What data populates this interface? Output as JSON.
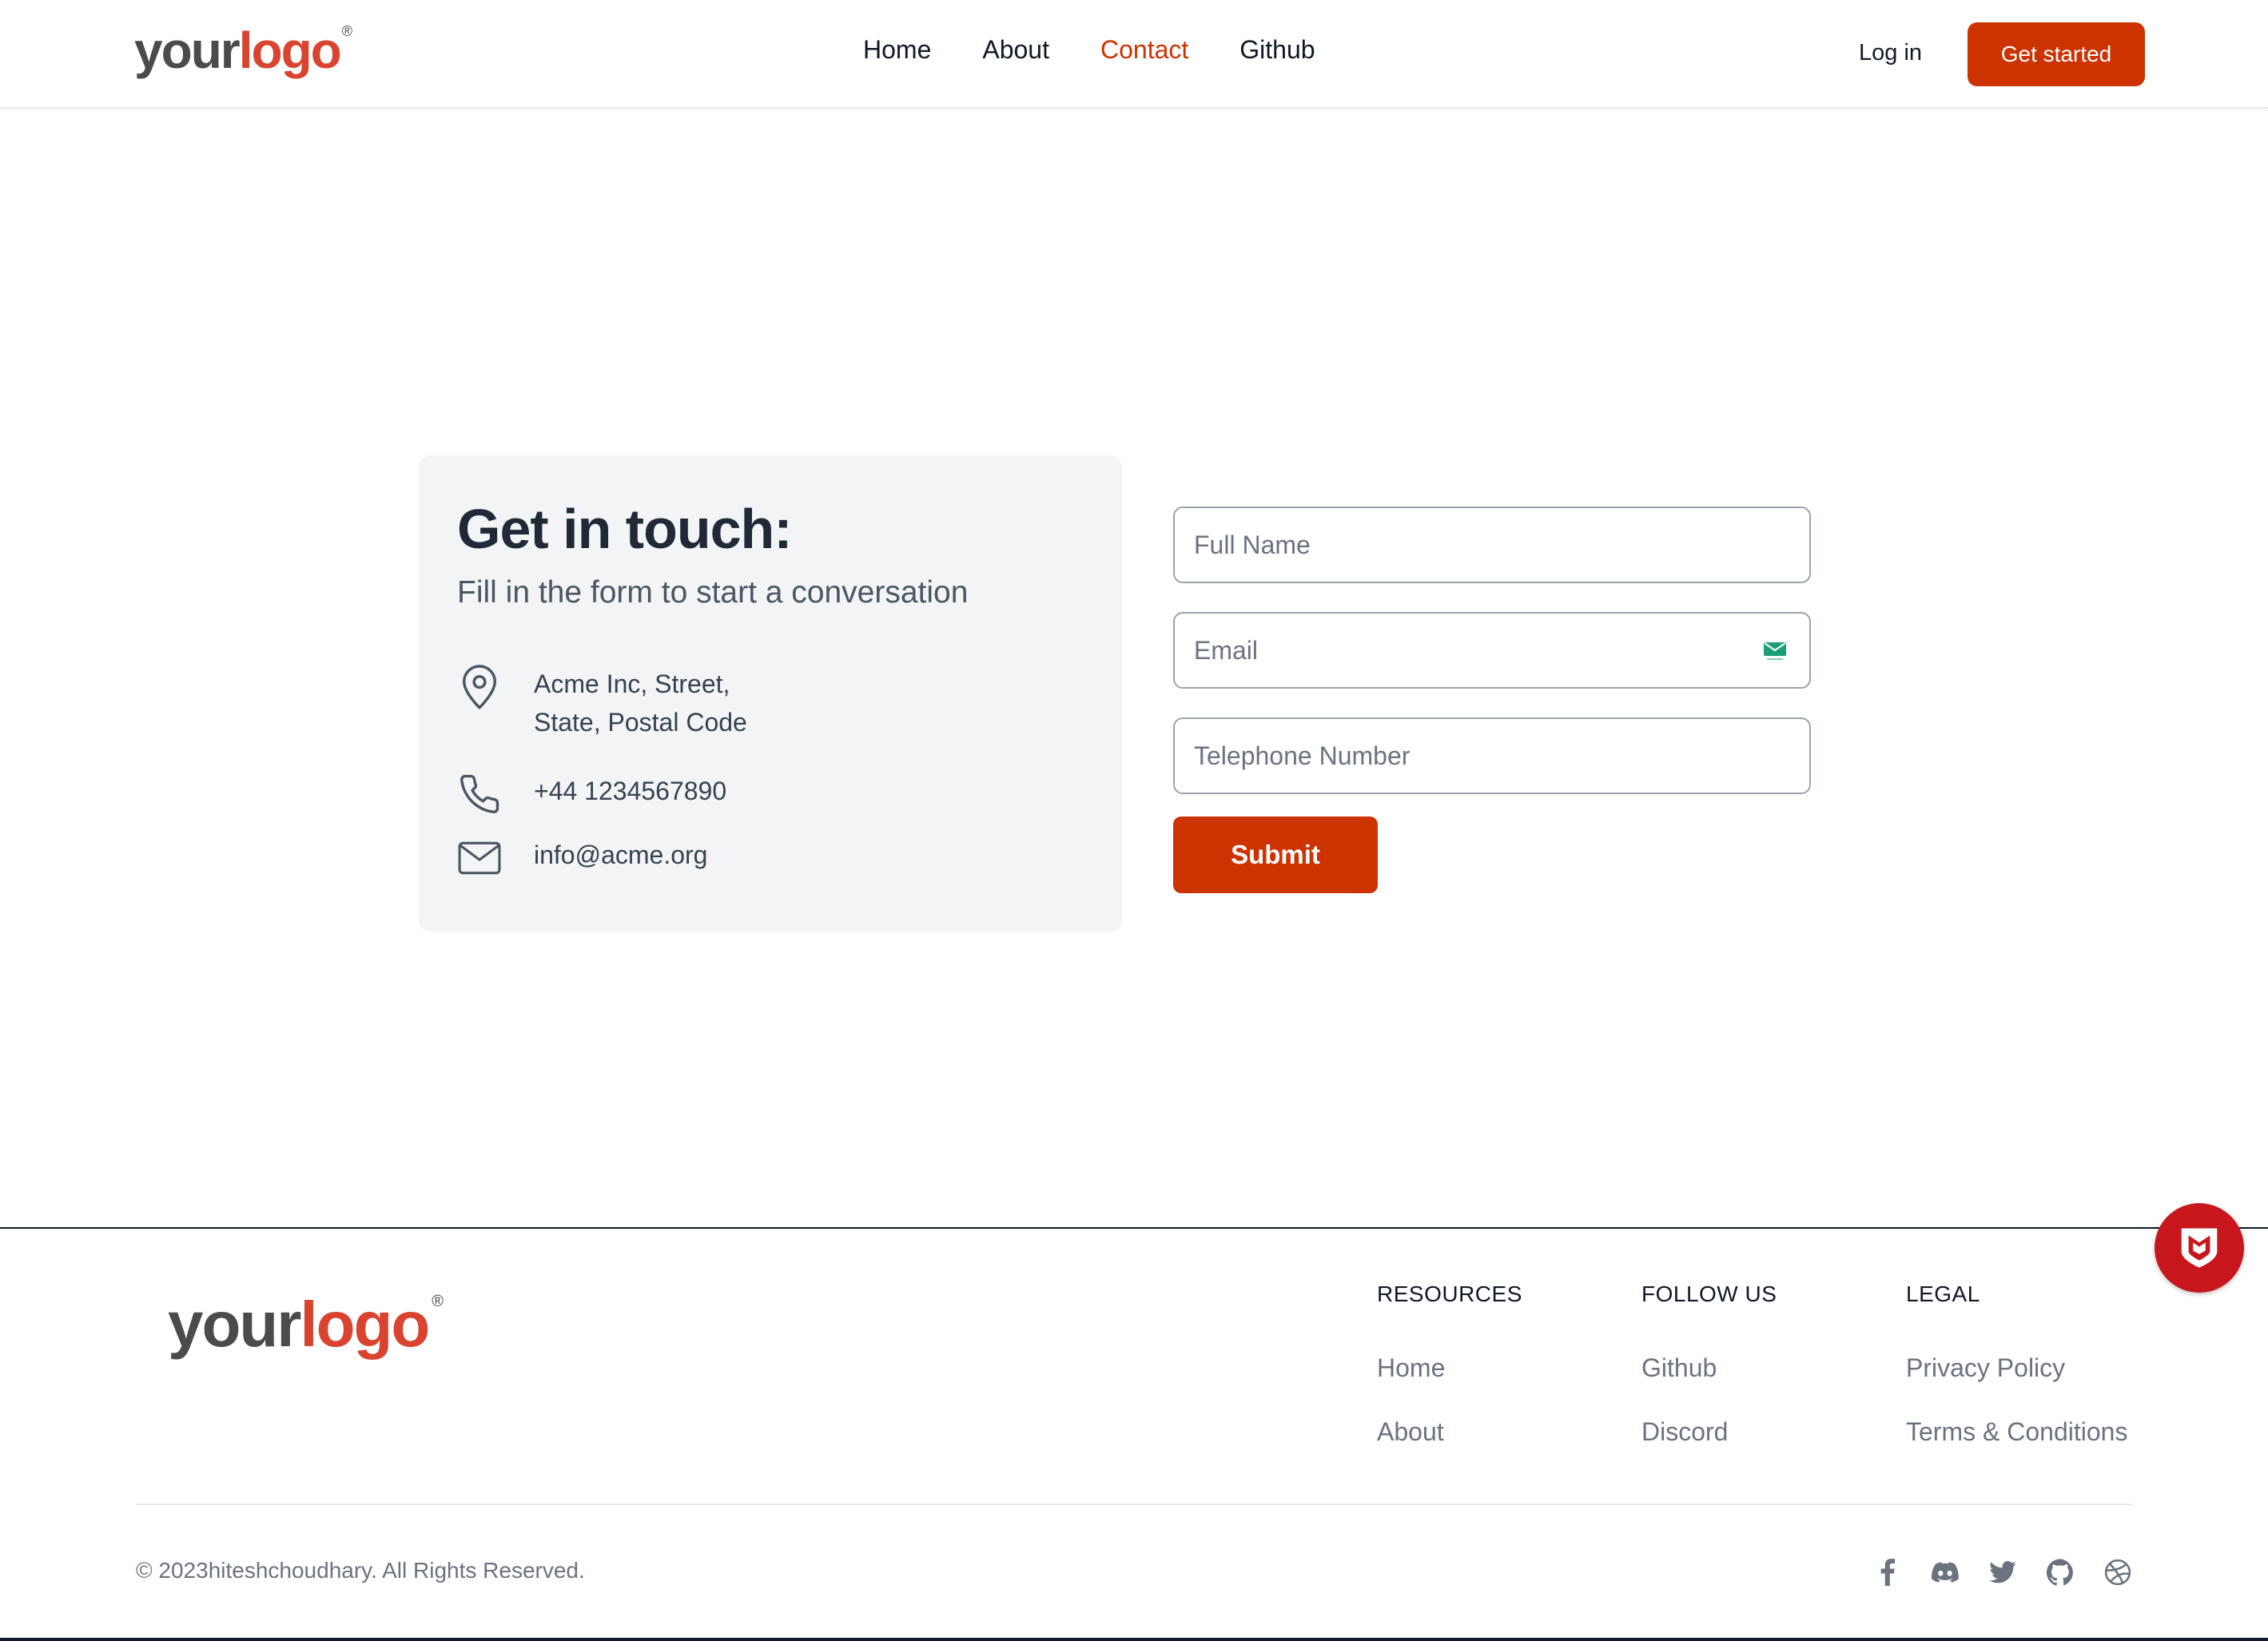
{
  "header": {
    "logo": {
      "word1": "your",
      "word2": "logo",
      "reg": "®"
    },
    "nav": [
      {
        "label": "Home"
      },
      {
        "label": "About"
      },
      {
        "label": "Contact"
      },
      {
        "label": "Github"
      }
    ],
    "active_nav": "Contact",
    "login_label": "Log in",
    "cta_label": "Get started"
  },
  "contact": {
    "title": "Get in touch:",
    "subtitle": "Fill in the form to start a conversation",
    "address_line1": "Acme Inc, Street,",
    "address_line2": "State, Postal Code",
    "phone": "+44 1234567890",
    "email": "info@acme.org"
  },
  "form": {
    "full_name_placeholder": "Full Name",
    "email_placeholder": "Email",
    "phone_placeholder": "Telephone Number",
    "submit_label": "Submit"
  },
  "footer": {
    "logo": {
      "word1": "your",
      "word2": "logo",
      "reg": "®"
    },
    "columns": [
      {
        "heading": "RESOURCES",
        "links": [
          "Home",
          "About"
        ]
      },
      {
        "heading": "FOLLOW US",
        "links": [
          "Github",
          "Discord"
        ]
      },
      {
        "heading": "LEGAL",
        "links": [
          "Privacy Policy",
          "Terms & Conditions"
        ]
      }
    ],
    "copyright": "© 2023hiteshchoudhary. All Rights Reserved.",
    "social_icons": [
      "facebook-icon",
      "discord-icon",
      "twitter-icon",
      "github-icon",
      "dribbble-icon"
    ]
  },
  "colors": {
    "accent": "#cc3300",
    "text_dark": "#1f2937",
    "muted": "#6b7280",
    "card_bg": "#f3f4f6",
    "security_badge": "#c8161d"
  }
}
